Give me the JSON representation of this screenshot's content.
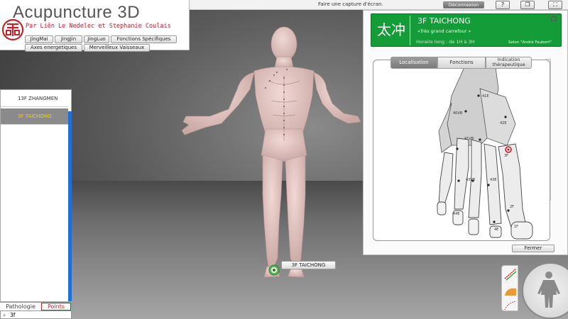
{
  "topbar": {
    "capture_text": "Faire une capture d'écran.",
    "logout_label": "Déconnexion",
    "help_icon": "?",
    "window_icon": "window-icon",
    "fullscreen_icon": "fullscreen-icon"
  },
  "logo": {
    "title": "Acupuncture 3D",
    "subtitle": "Par Liên Le Nedelec et Stephanie Coulais"
  },
  "nav": {
    "jingmai": "JingMai",
    "jingjin": "JingJin",
    "jingluo": "JingLuo",
    "fonctions": "Fonctions Spécifiques",
    "axes": "Axes energetiques",
    "merveilleux": "Merveilleux Vaisseaux"
  },
  "left_list": {
    "items": [
      "13F ZHANGMEN",
      "3F TAICHONG"
    ],
    "selected": "3F TAICHONG"
  },
  "left_tabs": {
    "pathologie": "Pathologie",
    "points": "Points"
  },
  "search": {
    "value": "3f"
  },
  "viewport": {
    "point_label": "3F TAICHONG"
  },
  "point_panel": {
    "hanzi": "太冲",
    "code": "3F TAICHONG",
    "meaning": "«Très grand carrefour »",
    "hours": "Horaire long : de 1H à 3H",
    "source": "Selon \"André Faubert\"",
    "tabs": {
      "localisation": "Localisation",
      "fonctions": "Fonctions",
      "indication": "Indication thérapeutique"
    },
    "close_label": "Fermer",
    "diagram_labels": [
      "41E",
      "40VB",
      "42E",
      "41VB",
      "43VB",
      "43E",
      "44E",
      "2F",
      "3F",
      "1F",
      "4E"
    ],
    "accent": "#149c38"
  }
}
